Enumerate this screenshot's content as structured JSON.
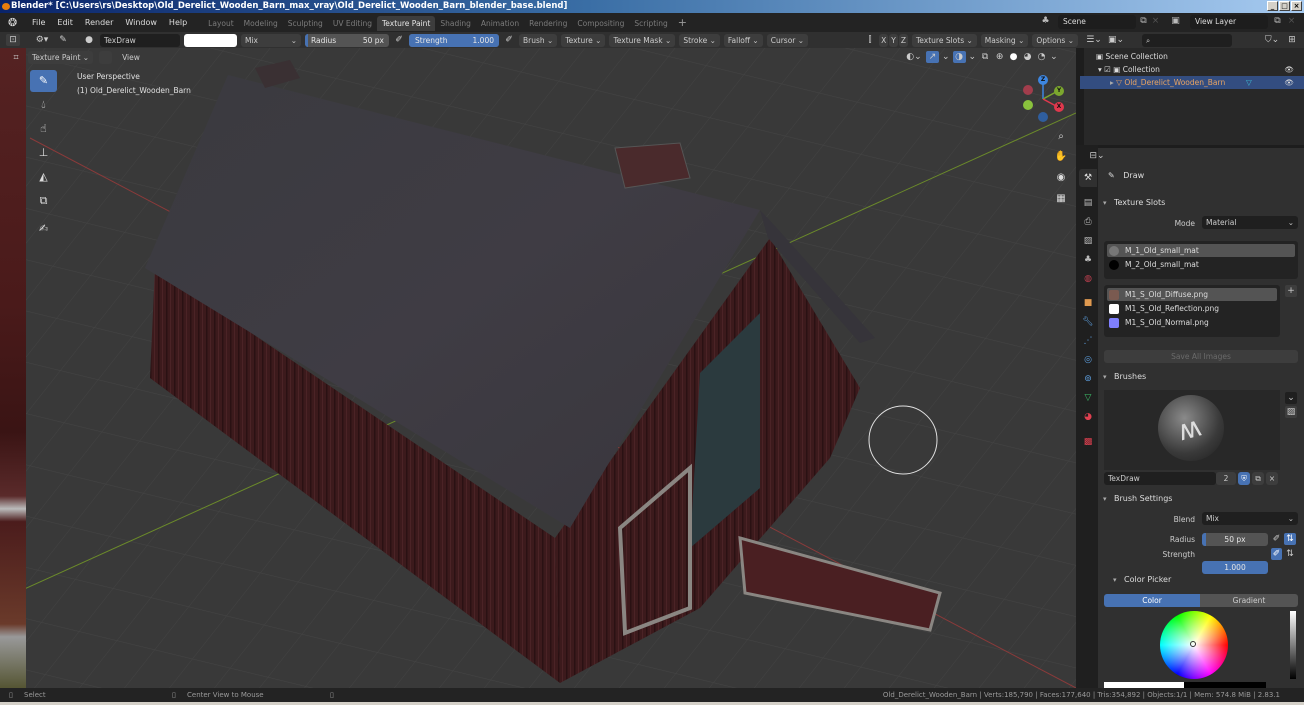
{
  "window": {
    "title": "Blender* [C:\\Users\\rs\\Desktop\\Old_Derelict_Wooden_Barn_max_vray\\Old_Derelict_Wooden_Barn_blender_base.blend]",
    "buttons": [
      "_",
      "□",
      "×"
    ]
  },
  "menubar": {
    "menus": [
      "File",
      "Edit",
      "Render",
      "Window",
      "Help"
    ],
    "workspaces": [
      "Layout",
      "Modeling",
      "Sculpting",
      "UV Editing",
      "Texture Paint",
      "Shading",
      "Animation",
      "Rendering",
      "Compositing",
      "Scripting"
    ],
    "active_workspace": "Texture Paint",
    "add_workspace": "+",
    "scene": "Scene",
    "view_layer": "View Layer"
  },
  "tool_header": {
    "brush_name": "TexDraw",
    "blend_mode": "Mix",
    "radius_label": "Radius",
    "radius_value": "50 px",
    "strength_label": "Strength",
    "strength_value": "1.000",
    "strength_fraction": 1.0,
    "menus": [
      "Brush",
      "Texture",
      "Texture Mask",
      "Stroke",
      "Falloff",
      "Cursor"
    ],
    "axes": [
      "X",
      "Y",
      "Z"
    ],
    "right_menus": [
      "Texture Slots",
      "Masking",
      "Options"
    ]
  },
  "viewport": {
    "mode": "Texture Paint",
    "view_menu": "View",
    "perspective_label": "User Perspective",
    "object_label": "(1) Old_Derelict_Wooden_Barn",
    "gizmo_axes": {
      "x": "X",
      "y": "Y",
      "z": "Z"
    },
    "colors": {
      "grid": "#393939",
      "x_axis": "#8a3a3a",
      "y_axis": "#6b8a2a",
      "roof": "#3d3b42",
      "walls": "#3e1a1c"
    }
  },
  "tools": [
    {
      "name": "draw",
      "icon": "brush-icon",
      "active": true
    },
    {
      "name": "soften",
      "icon": "drop-icon"
    },
    {
      "name": "smear",
      "icon": "smear-icon"
    },
    {
      "name": "clone",
      "icon": "stamp-icon"
    },
    {
      "name": "fill",
      "icon": "bucket-icon"
    },
    {
      "name": "mask",
      "icon": "mask-icon"
    },
    {
      "name": "annotate",
      "icon": "annotate-icon"
    }
  ],
  "outliner": {
    "scene_collection": "Scene Collection",
    "collection": "Collection",
    "object": "Old_Derelict_Wooden_Barn"
  },
  "properties": {
    "active_tool": "Draw",
    "texture_slots": {
      "title": "Texture Slots",
      "mode_label": "Mode",
      "mode_value": "Material",
      "materials": [
        "M_1_Old_small_mat",
        "M_2_Old_small_mat"
      ],
      "images": [
        {
          "name": "M1_S_Old_Diffuse.png",
          "color": "#7a5a50"
        },
        {
          "name": "M1_S_Old_Reflection.png",
          "color": "#ffffff"
        },
        {
          "name": "M1_S_Old_Normal.png",
          "color": "#8080ff"
        }
      ],
      "save_all": "Save All Images"
    },
    "brushes": {
      "title": "Brushes",
      "brush_name": "TexDraw",
      "users": "2"
    },
    "brush_settings": {
      "title": "Brush Settings",
      "blend_label": "Blend",
      "blend_value": "Mix",
      "radius_label": "Radius",
      "radius_value": "50 px",
      "strength_label": "Strength",
      "strength_value": "1.000"
    },
    "color_picker": {
      "title": "Color Picker",
      "tabs": [
        "Color",
        "Gradient"
      ],
      "active_tab": "Color"
    }
  },
  "statusbar": {
    "left": [
      "Select",
      "Center View to Mouse"
    ],
    "stats": "Old_Derelict_Wooden_Barn | Verts:185,790 | Faces:177,640 | Tris:354,892 | Objects:1/1 | Mem: 574.8 MiB | 2.83.1"
  }
}
